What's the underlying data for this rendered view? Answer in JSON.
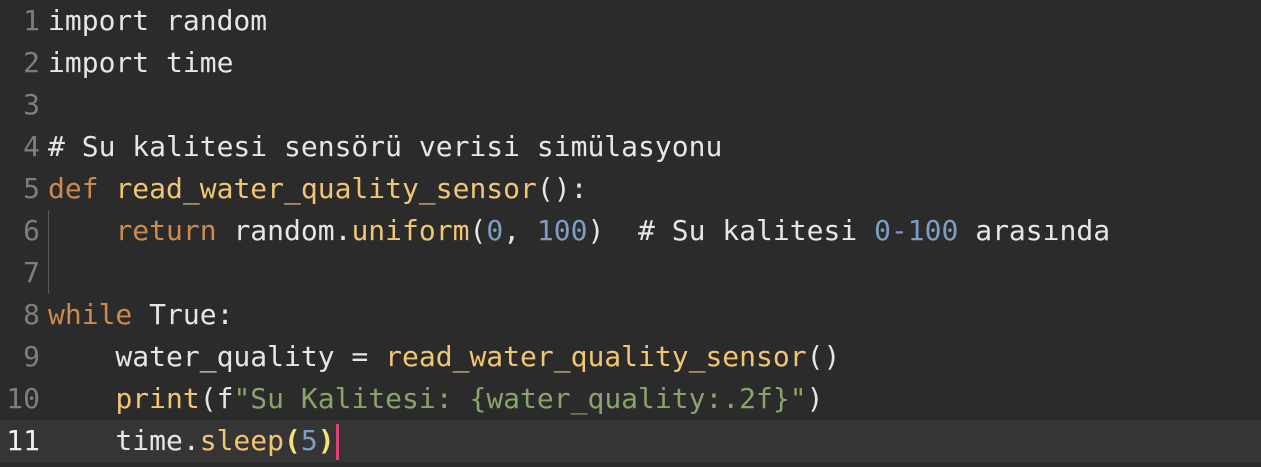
{
  "editor": {
    "current_line": "11",
    "lines": [
      {
        "num": "1",
        "tokens": [
          {
            "t": "import random",
            "c": "plain"
          }
        ]
      },
      {
        "num": "2",
        "tokens": [
          {
            "t": "import time",
            "c": "plain"
          }
        ]
      },
      {
        "num": "3",
        "tokens": []
      },
      {
        "num": "4",
        "tokens": [
          {
            "t": "# Su kalitesi sensörü verisi simülasyonu",
            "c": "cm"
          }
        ]
      },
      {
        "num": "5",
        "tokens": [
          {
            "t": "def",
            "c": "kw"
          },
          {
            "t": " ",
            "c": "plain"
          },
          {
            "t": "read_water_quality_sensor",
            "c": "fn"
          },
          {
            "t": "():",
            "c": "plain"
          }
        ]
      },
      {
        "num": "6",
        "tokens": [
          {
            "t": "    ",
            "c": "plain"
          },
          {
            "t": "return",
            "c": "kw"
          },
          {
            "t": " random.",
            "c": "plain"
          },
          {
            "t": "uniform",
            "c": "fn"
          },
          {
            "t": "(",
            "c": "plain"
          },
          {
            "t": "0",
            "c": "num"
          },
          {
            "t": ", ",
            "c": "plain"
          },
          {
            "t": "100",
            "c": "num"
          },
          {
            "t": ")  # Su kalitesi ",
            "c": "plain"
          },
          {
            "t": "0-100",
            "c": "num"
          },
          {
            "t": " arasında",
            "c": "plain"
          }
        ]
      },
      {
        "num": "7",
        "tokens": []
      },
      {
        "num": "8",
        "tokens": [
          {
            "t": "while",
            "c": "kw"
          },
          {
            "t": " True:",
            "c": "plain"
          }
        ]
      },
      {
        "num": "9",
        "tokens": [
          {
            "t": "    water_quality = ",
            "c": "plain"
          },
          {
            "t": "read_water_quality_sensor",
            "c": "fn"
          },
          {
            "t": "()",
            "c": "plain"
          }
        ]
      },
      {
        "num": "10",
        "tokens": [
          {
            "t": "    ",
            "c": "plain"
          },
          {
            "t": "print",
            "c": "fn"
          },
          {
            "t": "(f",
            "c": "plain"
          },
          {
            "t": "\"Su Kalitesi: {water_quality:.2f}\"",
            "c": "str"
          },
          {
            "t": ")",
            "c": "plain"
          }
        ]
      },
      {
        "num": "11",
        "tokens": [
          {
            "t": "    time.",
            "c": "plain"
          },
          {
            "t": "sleep",
            "c": "fn"
          },
          {
            "t": "(",
            "c": "bracket-match"
          },
          {
            "t": "5",
            "c": "num"
          },
          {
            "t": ")",
            "c": "bracket-match"
          }
        ]
      }
    ]
  },
  "colors": {
    "background": "#2b2b2b",
    "keyword": "#cc8a4f",
    "function": "#f0c674",
    "number": "#7f9dc2",
    "string": "#8aa36b",
    "caret": "#e0407e"
  }
}
